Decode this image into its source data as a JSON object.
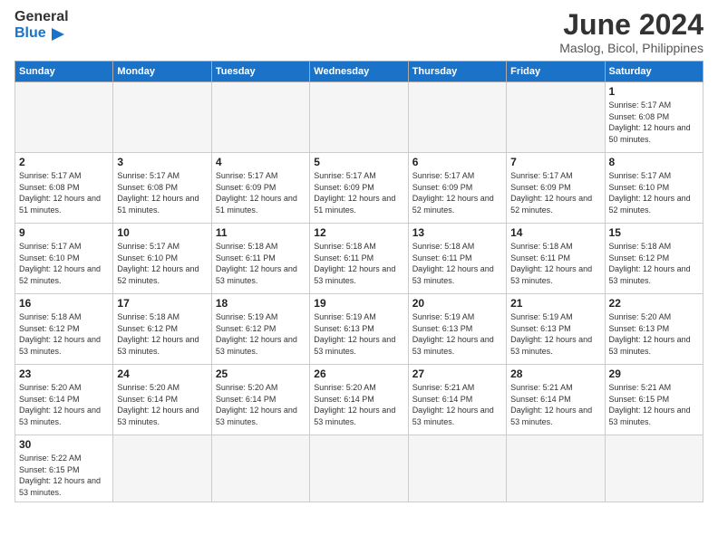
{
  "logo": {
    "general": "General",
    "blue": "Blue"
  },
  "title": {
    "month_year": "June 2024",
    "location": "Maslog, Bicol, Philippines"
  },
  "weekdays": [
    "Sunday",
    "Monday",
    "Tuesday",
    "Wednesday",
    "Thursday",
    "Friday",
    "Saturday"
  ],
  "weeks": [
    [
      {
        "day": "",
        "empty": true
      },
      {
        "day": "",
        "empty": true
      },
      {
        "day": "",
        "empty": true
      },
      {
        "day": "",
        "empty": true
      },
      {
        "day": "",
        "empty": true
      },
      {
        "day": "",
        "empty": true
      },
      {
        "day": "1",
        "sunrise": "5:17 AM",
        "sunset": "6:08 PM",
        "daylight": "12 hours and 50 minutes."
      }
    ],
    [
      {
        "day": "2",
        "sunrise": "5:17 AM",
        "sunset": "6:08 PM",
        "daylight": "12 hours and 51 minutes."
      },
      {
        "day": "3",
        "sunrise": "5:17 AM",
        "sunset": "6:08 PM",
        "daylight": "12 hours and 51 minutes."
      },
      {
        "day": "4",
        "sunrise": "5:17 AM",
        "sunset": "6:09 PM",
        "daylight": "12 hours and 51 minutes."
      },
      {
        "day": "5",
        "sunrise": "5:17 AM",
        "sunset": "6:09 PM",
        "daylight": "12 hours and 51 minutes."
      },
      {
        "day": "6",
        "sunrise": "5:17 AM",
        "sunset": "6:09 PM",
        "daylight": "12 hours and 52 minutes."
      },
      {
        "day": "7",
        "sunrise": "5:17 AM",
        "sunset": "6:09 PM",
        "daylight": "12 hours and 52 minutes."
      },
      {
        "day": "8",
        "sunrise": "5:17 AM",
        "sunset": "6:10 PM",
        "daylight": "12 hours and 52 minutes."
      }
    ],
    [
      {
        "day": "9",
        "sunrise": "5:17 AM",
        "sunset": "6:10 PM",
        "daylight": "12 hours and 52 minutes."
      },
      {
        "day": "10",
        "sunrise": "5:17 AM",
        "sunset": "6:10 PM",
        "daylight": "12 hours and 52 minutes."
      },
      {
        "day": "11",
        "sunrise": "5:18 AM",
        "sunset": "6:11 PM",
        "daylight": "12 hours and 53 minutes."
      },
      {
        "day": "12",
        "sunrise": "5:18 AM",
        "sunset": "6:11 PM",
        "daylight": "12 hours and 53 minutes."
      },
      {
        "day": "13",
        "sunrise": "5:18 AM",
        "sunset": "6:11 PM",
        "daylight": "12 hours and 53 minutes."
      },
      {
        "day": "14",
        "sunrise": "5:18 AM",
        "sunset": "6:11 PM",
        "daylight": "12 hours and 53 minutes."
      },
      {
        "day": "15",
        "sunrise": "5:18 AM",
        "sunset": "6:12 PM",
        "daylight": "12 hours and 53 minutes."
      }
    ],
    [
      {
        "day": "16",
        "sunrise": "5:18 AM",
        "sunset": "6:12 PM",
        "daylight": "12 hours and 53 minutes."
      },
      {
        "day": "17",
        "sunrise": "5:18 AM",
        "sunset": "6:12 PM",
        "daylight": "12 hours and 53 minutes."
      },
      {
        "day": "18",
        "sunrise": "5:19 AM",
        "sunset": "6:12 PM",
        "daylight": "12 hours and 53 minutes."
      },
      {
        "day": "19",
        "sunrise": "5:19 AM",
        "sunset": "6:13 PM",
        "daylight": "12 hours and 53 minutes."
      },
      {
        "day": "20",
        "sunrise": "5:19 AM",
        "sunset": "6:13 PM",
        "daylight": "12 hours and 53 minutes."
      },
      {
        "day": "21",
        "sunrise": "5:19 AM",
        "sunset": "6:13 PM",
        "daylight": "12 hours and 53 minutes."
      },
      {
        "day": "22",
        "sunrise": "5:20 AM",
        "sunset": "6:13 PM",
        "daylight": "12 hours and 53 minutes."
      }
    ],
    [
      {
        "day": "23",
        "sunrise": "5:20 AM",
        "sunset": "6:14 PM",
        "daylight": "12 hours and 53 minutes."
      },
      {
        "day": "24",
        "sunrise": "5:20 AM",
        "sunset": "6:14 PM",
        "daylight": "12 hours and 53 minutes."
      },
      {
        "day": "25",
        "sunrise": "5:20 AM",
        "sunset": "6:14 PM",
        "daylight": "12 hours and 53 minutes."
      },
      {
        "day": "26",
        "sunrise": "5:20 AM",
        "sunset": "6:14 PM",
        "daylight": "12 hours and 53 minutes."
      },
      {
        "day": "27",
        "sunrise": "5:21 AM",
        "sunset": "6:14 PM",
        "daylight": "12 hours and 53 minutes."
      },
      {
        "day": "28",
        "sunrise": "5:21 AM",
        "sunset": "6:14 PM",
        "daylight": "12 hours and 53 minutes."
      },
      {
        "day": "29",
        "sunrise": "5:21 AM",
        "sunset": "6:15 PM",
        "daylight": "12 hours and 53 minutes."
      }
    ],
    [
      {
        "day": "30",
        "sunrise": "5:22 AM",
        "sunset": "6:15 PM",
        "daylight": "12 hours and 53 minutes."
      },
      {
        "day": "",
        "empty": true
      },
      {
        "day": "",
        "empty": true
      },
      {
        "day": "",
        "empty": true
      },
      {
        "day": "",
        "empty": true
      },
      {
        "day": "",
        "empty": true
      },
      {
        "day": "",
        "empty": true
      }
    ]
  ]
}
